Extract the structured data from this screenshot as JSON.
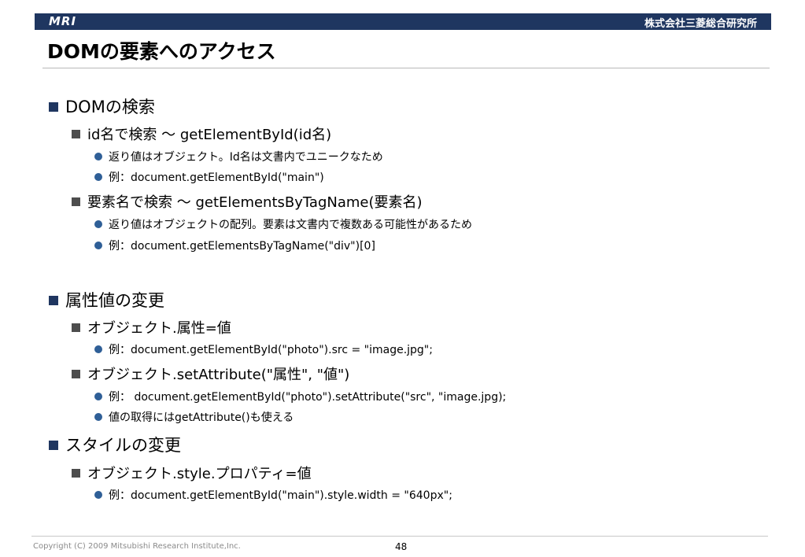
{
  "header": {
    "logo_text": "MRI",
    "company": "株式会社三菱総合研究所",
    "bar_color": "#1f3660"
  },
  "title": "DOMの要素へのアクセス",
  "sections": [
    {
      "heading": "DOMの検索",
      "items": [
        {
          "text": "id名で検索 ～ getElementById(id名)",
          "bullets": [
            "返り値はオブジェクト。Id名は文書内でユニークなため",
            "例：document.getElementById(\"main\")"
          ]
        },
        {
          "text": "要素名で検索 ～ getElementsByTagName(要素名)",
          "bullets": [
            "返り値はオブジェクトの配列。要素は文書内で複数ある可能性があるため",
            "例：document.getElementsByTagName(\"div\")[0]"
          ]
        }
      ]
    },
    {
      "heading": "属性値の変更",
      "items": [
        {
          "text": "オブジェクト.属性=値",
          "bullets": [
            "例：document.getElementById(\"photo\").src = \"image.jpg\";"
          ]
        },
        {
          "text": "オブジェクト.setAttribute(\"属性\", \"値\")",
          "bullets": [
            "例： document.getElementById(\"photo\").setAttribute(\"src\", \"image.jpg);",
            "値の取得にはgetAttribute()も使える"
          ]
        }
      ]
    },
    {
      "heading": "スタイルの変更",
      "items": [
        {
          "text": "オブジェクト.style.プロパティ=値",
          "bullets": [
            "例：document.getElementById(\"main\").style.width = \"640px\";"
          ]
        }
      ]
    }
  ],
  "footer": {
    "copyright": "Copyright (C) 2009 Mitsubishi Research Institute,Inc.",
    "page_number": "48"
  }
}
